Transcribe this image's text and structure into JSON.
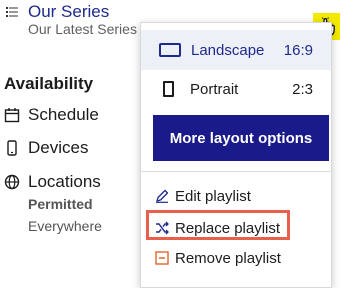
{
  "header": {
    "title": "Our Series",
    "subtitle": "Our Latest Series"
  },
  "availability": {
    "heading": "Availability",
    "items": [
      {
        "label": "Schedule",
        "icon": "calendar-icon"
      },
      {
        "label": "Devices",
        "icon": "phone-icon"
      },
      {
        "label": "Locations",
        "icon": "globe-icon"
      }
    ],
    "locations_status": "Permitted",
    "locations_value": "Everywhere"
  },
  "layout_menu": {
    "options": [
      {
        "label": "Landscape",
        "ratio": "16:9",
        "selected": true
      },
      {
        "label": "Portrait",
        "ratio": "2:3",
        "selected": false
      }
    ],
    "more_button": "More layout options",
    "actions": [
      {
        "label": "Edit playlist",
        "icon": "pencil-icon"
      },
      {
        "label": "Replace playlist",
        "icon": "shuffle-icon"
      },
      {
        "label": "Remove playlist",
        "icon": "minus-box-icon"
      }
    ]
  },
  "colors": {
    "brand_blue": "#1a1a8a",
    "title_blue": "#1e2a8c",
    "cursor_highlight": "#f4ea00",
    "callout_red": "#e8604c",
    "remove_orange": "#e0662f"
  }
}
